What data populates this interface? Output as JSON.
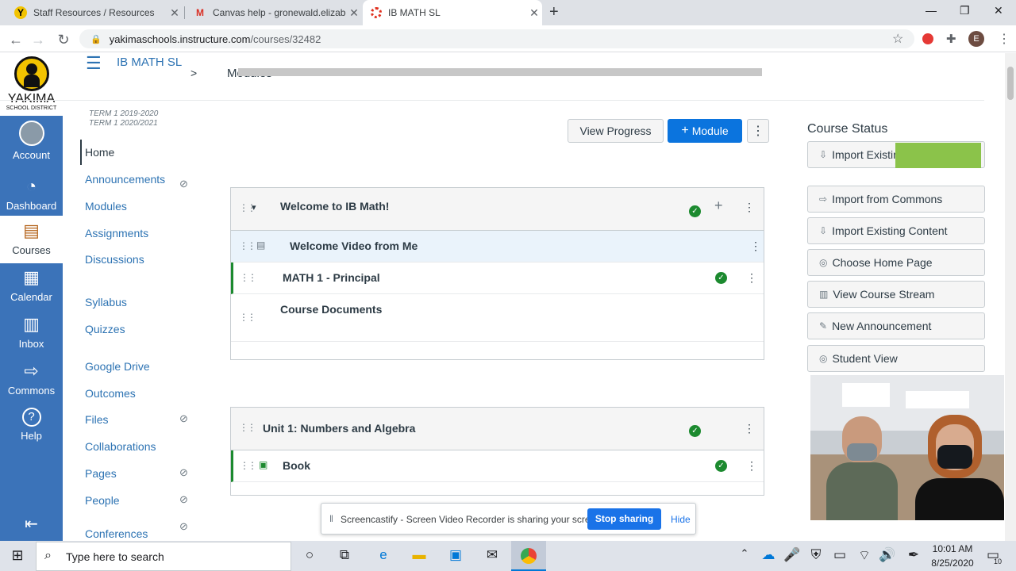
{
  "browser": {
    "tabs": [
      {
        "title": "Staff Resources / Resources",
        "favicon": "Y"
      },
      {
        "title": "Canvas help - gronewald.elizabet",
        "favicon": "M"
      },
      {
        "title": "IB MATH SL",
        "favicon": "canvas"
      }
    ],
    "new_tab": "+",
    "url_host": "yakimaschools.instructure.com",
    "url_path": "/courses/32482",
    "profile_initial": "E"
  },
  "global_nav": {
    "logo_title": "YAKIMA",
    "logo_subtitle": "SCHOOL DISTRICT",
    "items": [
      {
        "label": "Account",
        "icon": "avatar-icon"
      },
      {
        "label": "Dashboard",
        "icon": "dashboard-icon"
      },
      {
        "label": "Courses",
        "icon": "courses-icon"
      },
      {
        "label": "Calendar",
        "icon": "calendar-icon"
      },
      {
        "label": "Inbox",
        "icon": "inbox-icon"
      },
      {
        "label": "Commons",
        "icon": "commons-icon"
      },
      {
        "label": "Help",
        "icon": "help-icon"
      }
    ],
    "collapse_icon": "collapse-icon"
  },
  "header": {
    "breadcrumb_course": "IB MATH SL",
    "breadcrumb_sep": ">",
    "breadcrumb_page": "Modules",
    "term_1": "TERM 1 2019-2020",
    "term_2": "TERM 1 2020/2021"
  },
  "course_nav": [
    "Home",
    "Announcements",
    "Modules",
    "Assignments",
    "Discussions",
    "Syllabus",
    "Quizzes",
    "Google Drive",
    "Outcomes",
    "Files",
    "Collaborations",
    "Pages",
    "People",
    "Conferences"
  ],
  "toolbar": {
    "view_progress": "View Progress",
    "add_module": "Module",
    "add_module_prefix": "+"
  },
  "modules": [
    {
      "title": "Welcome to IB Math!",
      "items": [
        "Welcome Video from Me",
        "MATH 1 - Principal",
        "Course Documents"
      ]
    },
    {
      "title": "Unit 1: Numbers and Algebra",
      "items": [
        "Book"
      ]
    }
  ],
  "right_sidebar": {
    "heading": "Course Status",
    "buttons": [
      "Import Existing Content",
      "Import from Commons",
      "Choose Home Page",
      "View Course Stream",
      "New Announcement",
      "Student View"
    ]
  },
  "screencastify": {
    "message": "Screencastify - Screen Video Recorder is sharing your screen.",
    "stop_label": "Stop sharing",
    "hide_label": "Hide"
  },
  "taskbar": {
    "search_placeholder": "Type here to search",
    "time": "10:01 AM",
    "date": "8/25/2020",
    "notification_count": "10"
  },
  "colors": {
    "canvas_nav": "#3b73b9",
    "link": "#2d73b3",
    "primary_button": "#0b74de",
    "success": "#1c8a2f"
  }
}
